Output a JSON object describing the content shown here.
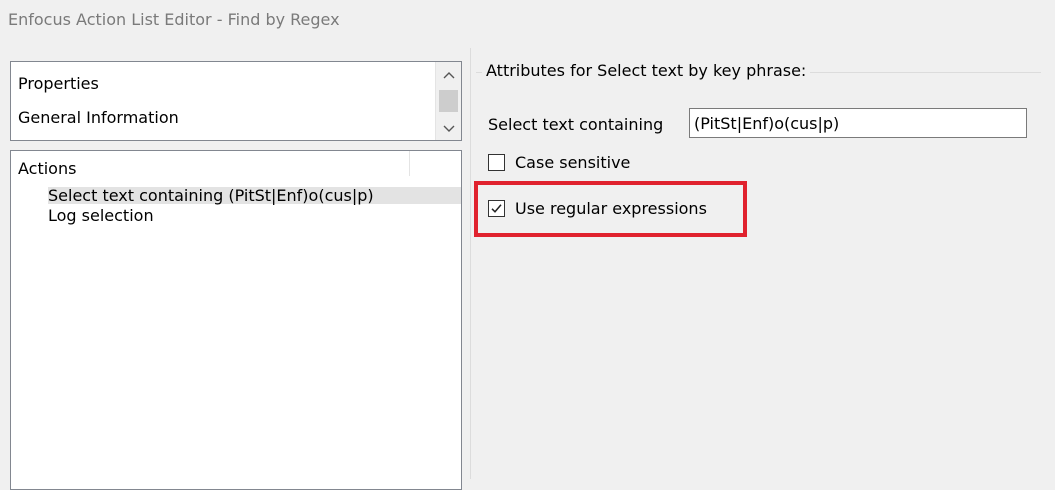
{
  "window": {
    "title": "Enfocus Action List Editor - Find by Regex"
  },
  "properties_list": {
    "items": [
      "Properties",
      "General Information"
    ],
    "scroll_up_icon": "chevron-up-icon",
    "scroll_down_icon": "chevron-down-icon"
  },
  "actions_tree": {
    "root_label": "Actions",
    "items": [
      {
        "label": "Select text containing (PitSt|Enf)o(cus|p)",
        "selected": true
      },
      {
        "label": "Log selection",
        "selected": false
      }
    ]
  },
  "attributes": {
    "group_title": "Attributes for Select text by key phrase:",
    "select_text_label": "Select text containing",
    "select_text_value": "(PitSt|Enf)o(cus|p)",
    "case_sensitive": {
      "label": "Case sensitive",
      "checked": false
    },
    "use_regex": {
      "label": "Use regular expressions",
      "checked": true
    }
  },
  "colors": {
    "highlight": "#e0222e",
    "selection": "#e3e3e3",
    "title_text": "#7a7a7a"
  }
}
